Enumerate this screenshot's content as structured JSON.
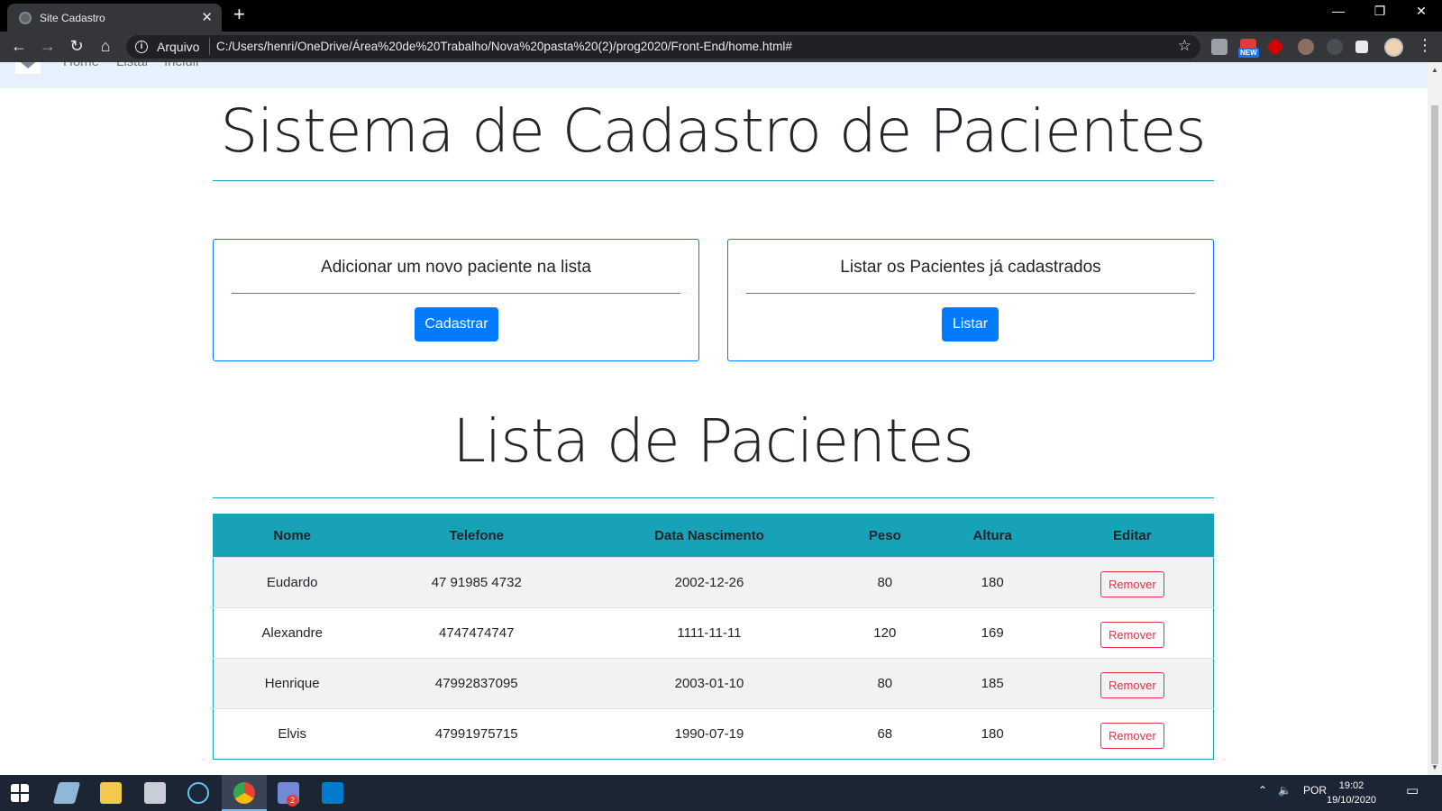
{
  "browser": {
    "tab_title": "Site Cadastro",
    "tab_close": "✕",
    "new_tab": "+",
    "scheme_label": "Arquivo",
    "url": "C:/Users/henri/OneDrive/Área%20de%20Trabalho/Nova%20pasta%20(2)/prog2020/Front-End/home.html#",
    "extension_badge": "NEW",
    "window_controls": {
      "minimize": "—",
      "restore": "❐",
      "close": "✕"
    },
    "nav": {
      "back": "←",
      "forward": "→",
      "reload": "↻",
      "home": "⌂"
    },
    "bookmark_star": "☆",
    "menu": "⋮"
  },
  "site": {
    "nav": [
      "Home",
      "Listar",
      "Incluir"
    ],
    "title": "Sistema de Cadastro de Pacientes",
    "cards": [
      {
        "title": "Adicionar um novo paciente na lista",
        "button": "Cadastrar"
      },
      {
        "title": "Listar os Pacientes já cadastrados",
        "button": "Listar"
      }
    ],
    "list_title": "Lista de Pacientes",
    "table": {
      "headers": [
        "Nome",
        "Telefone",
        "Data Nascimento",
        "Peso",
        "Altura",
        "Editar"
      ],
      "rows": [
        [
          "Eudardo",
          "47 91985 4732",
          "2002-12-26",
          "80",
          "180"
        ],
        [
          "Alexandre",
          "4747474747",
          "1111-11-11",
          "120",
          "169"
        ],
        [
          "Henrique",
          "47992837095",
          "2003-01-10",
          "80",
          "185"
        ],
        [
          "Elvis",
          "47991975715",
          "1990-07-19",
          "68",
          "180"
        ]
      ],
      "remove_label": "Remover"
    }
  },
  "taskbar": {
    "language": "POR",
    "time": "19:02",
    "date": "19/10/2020",
    "vscode_badge": "2"
  },
  "colors": {
    "primary": "#007bff",
    "info": "#17a2b8",
    "danger": "#dc3545",
    "navbar_bg": "#e7f1fd",
    "taskbar_bg": "#1c2533"
  }
}
